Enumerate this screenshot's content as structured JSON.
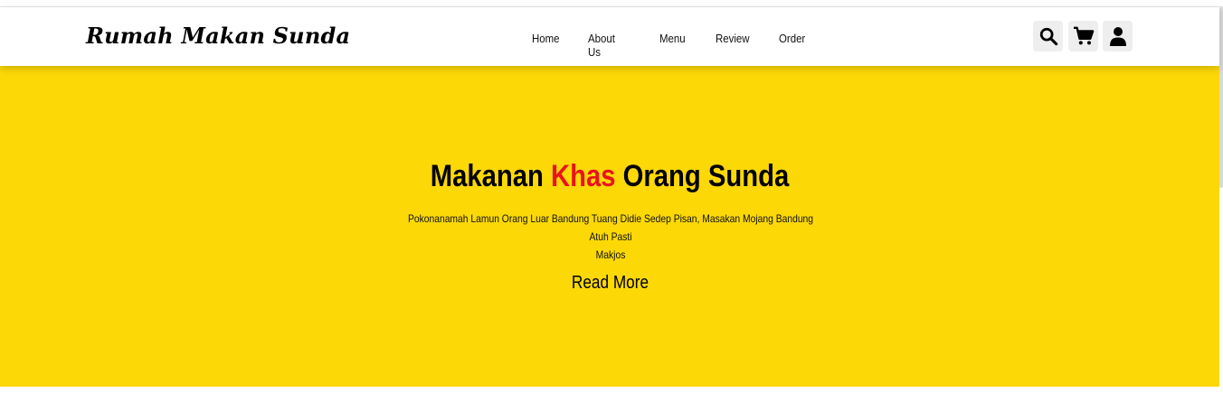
{
  "header": {
    "logo": "Rumah Makan Sunda",
    "nav": {
      "home": "Home",
      "about": "About Us",
      "menu": "Menu",
      "review": "Review",
      "order": "Order"
    },
    "icons": [
      "search-icon",
      "cart-icon",
      "user-icon"
    ]
  },
  "hero": {
    "title_part1": "Makanan ",
    "title_accent": "Khas",
    "title_part2": " Orang Sunda",
    "description_line1": "Pokonanamah Lamun Orang Luar Bandung Tuang Didie Sedep Pisan, Masakan Mojang Bandung Atuh Pasti",
    "description_line2": "Makjos",
    "read_more": "Read More"
  },
  "colors": {
    "hero_background": "#fcd806",
    "accent": "#e8141c",
    "header_background": "#ffffff",
    "icon_button_background": "#eeeeee"
  }
}
